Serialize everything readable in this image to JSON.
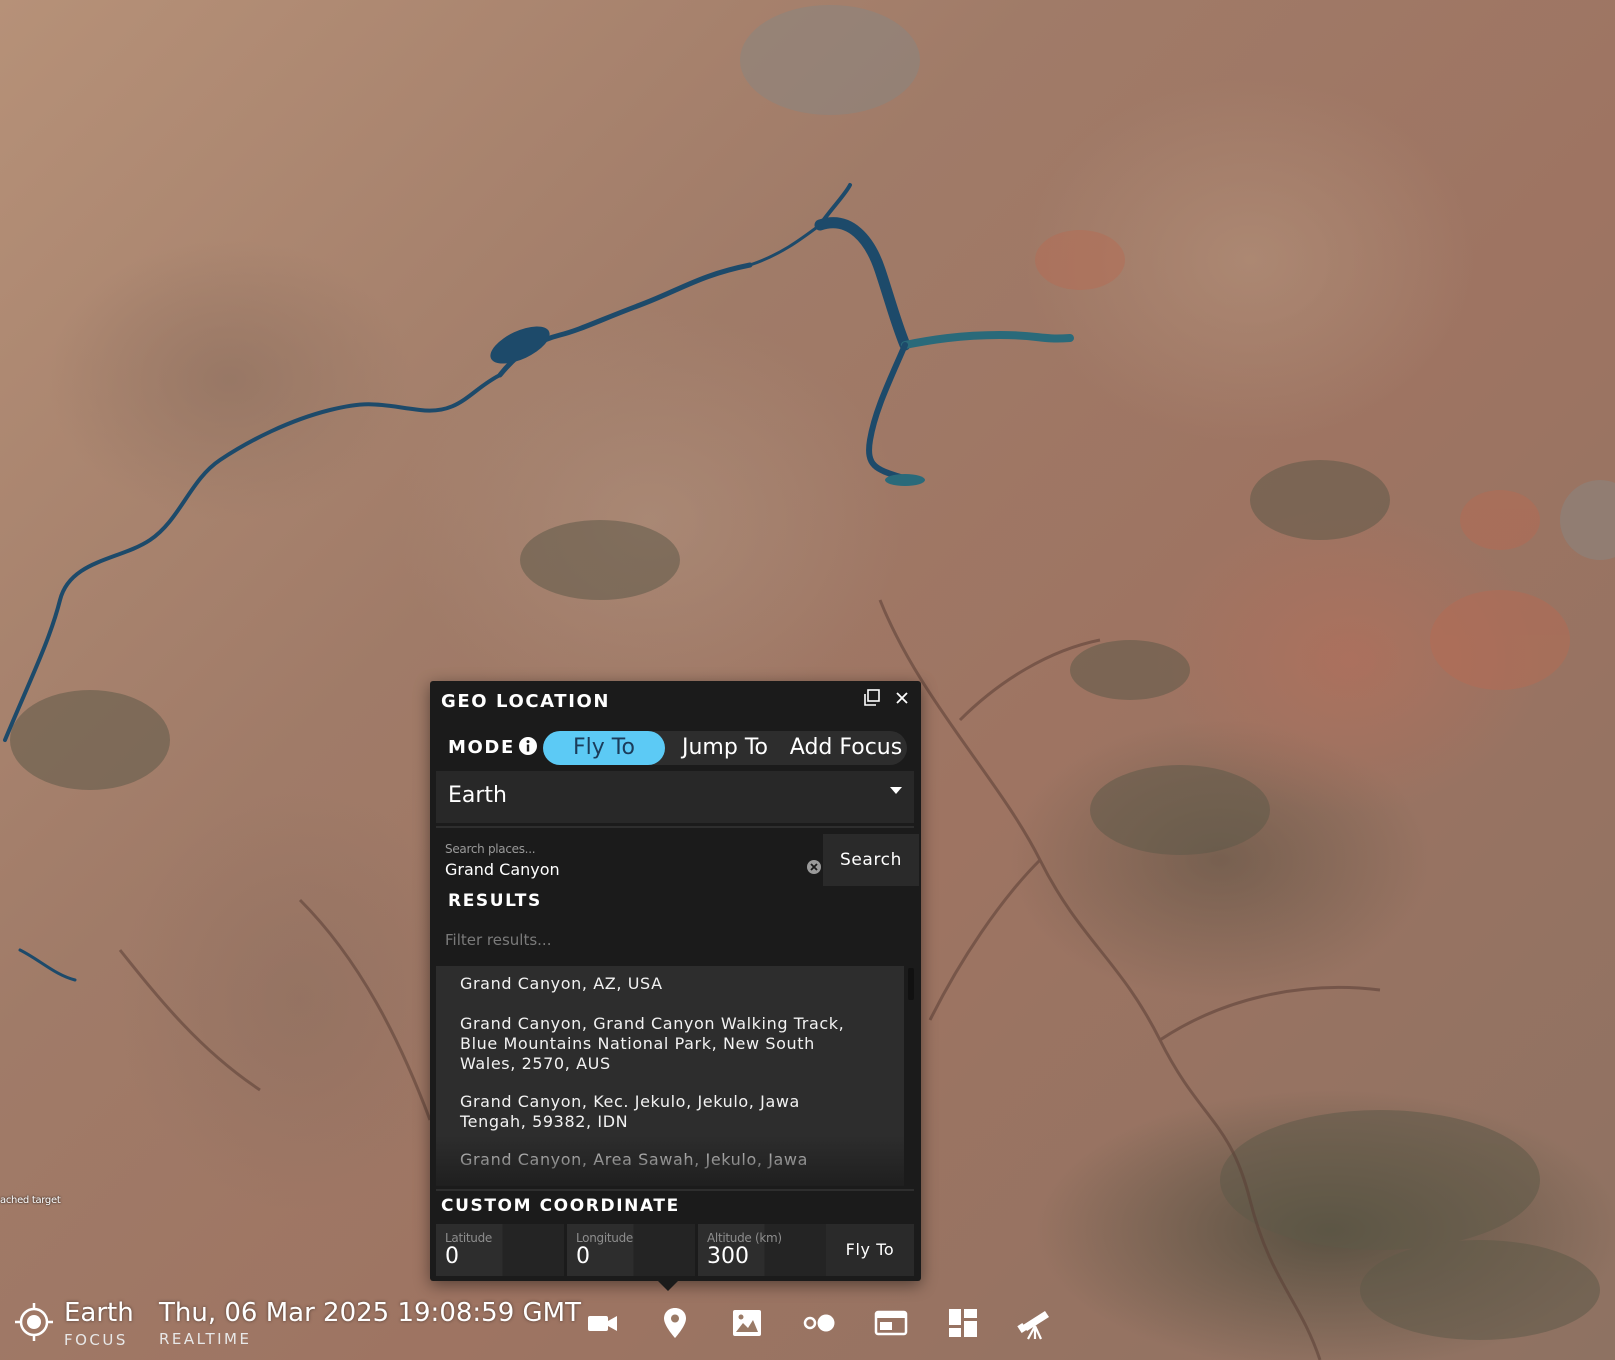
{
  "map": {
    "edge_label": "ached target"
  },
  "panel": {
    "title": "GEO LOCATION",
    "mode": {
      "label": "MODE",
      "options": [
        "Fly To",
        "Jump To",
        "Add Focus"
      ],
      "selected": "Fly To"
    },
    "body_select": {
      "value": "Earth"
    },
    "search": {
      "placeholder": "Search places...",
      "value": "Grand Canyon",
      "button": "Search"
    },
    "results": {
      "label": "RESULTS",
      "filter_placeholder": "Filter results...",
      "items": [
        "Grand Canyon, AZ, USA",
        "Grand Canyon, Grand Canyon Walking Track, Blue Mountains National Park, New South Wales, 2570, AUS",
        "Grand Canyon, Kec. Jekulo, Jekulo, Jawa Tengah, 59382, IDN",
        "Grand Canyon, Area Sawah, Jekulo, Jawa"
      ]
    },
    "custom_coordinate": {
      "label": "CUSTOM COORDINATE",
      "latitude": {
        "label": "Latitude",
        "value": "0"
      },
      "longitude": {
        "label": "Longitude",
        "value": "0"
      },
      "altitude": {
        "label": "Altitude (km)",
        "value": "300"
      },
      "button": "Fly To"
    }
  },
  "bottom_bar": {
    "focus": {
      "name": "Earth",
      "sub": "FOCUS"
    },
    "time": {
      "value": "Thu, 06 Mar 2025 19:08:59 GMT",
      "sub": "REALTIME"
    },
    "tools": [
      "camera-icon",
      "map-pin-icon",
      "image-icon",
      "toggle-dots-icon",
      "layout-window-icon",
      "dashboard-grid-icon",
      "telescope-icon"
    ]
  },
  "colors": {
    "accent": "#5ccaf5",
    "panel_bg": "#1b1b1b",
    "water": "#1d4a6a"
  }
}
